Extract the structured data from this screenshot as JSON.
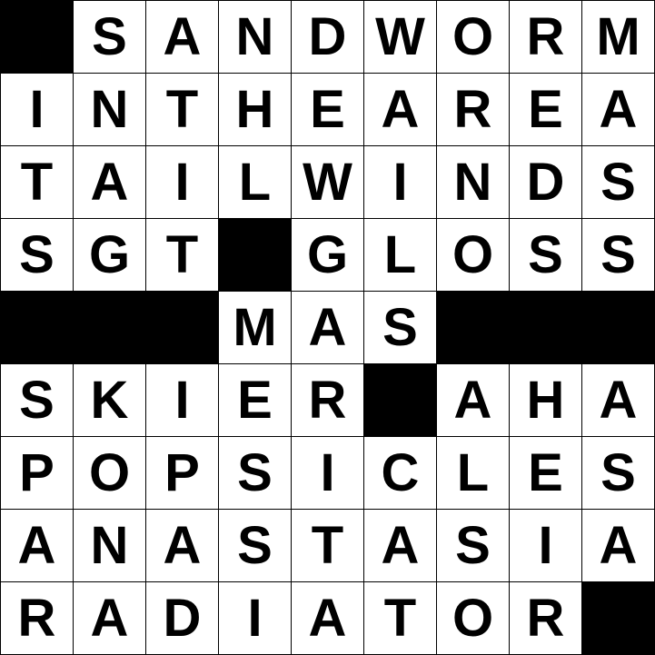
{
  "puzzle": {
    "rows": [
      "#SANDWORM",
      "INTHEAREA",
      "TAILWINDS",
      "SGT#GLOSS",
      "###MAS###",
      "SKIER#AHA",
      "POPSICLES",
      "ANASTASIA",
      "RADIATOR#"
    ],
    "colors": {
      "block": "#000000",
      "cell_background": "#ffffff",
      "letter": "#000000",
      "grid_line": "#000000"
    }
  }
}
